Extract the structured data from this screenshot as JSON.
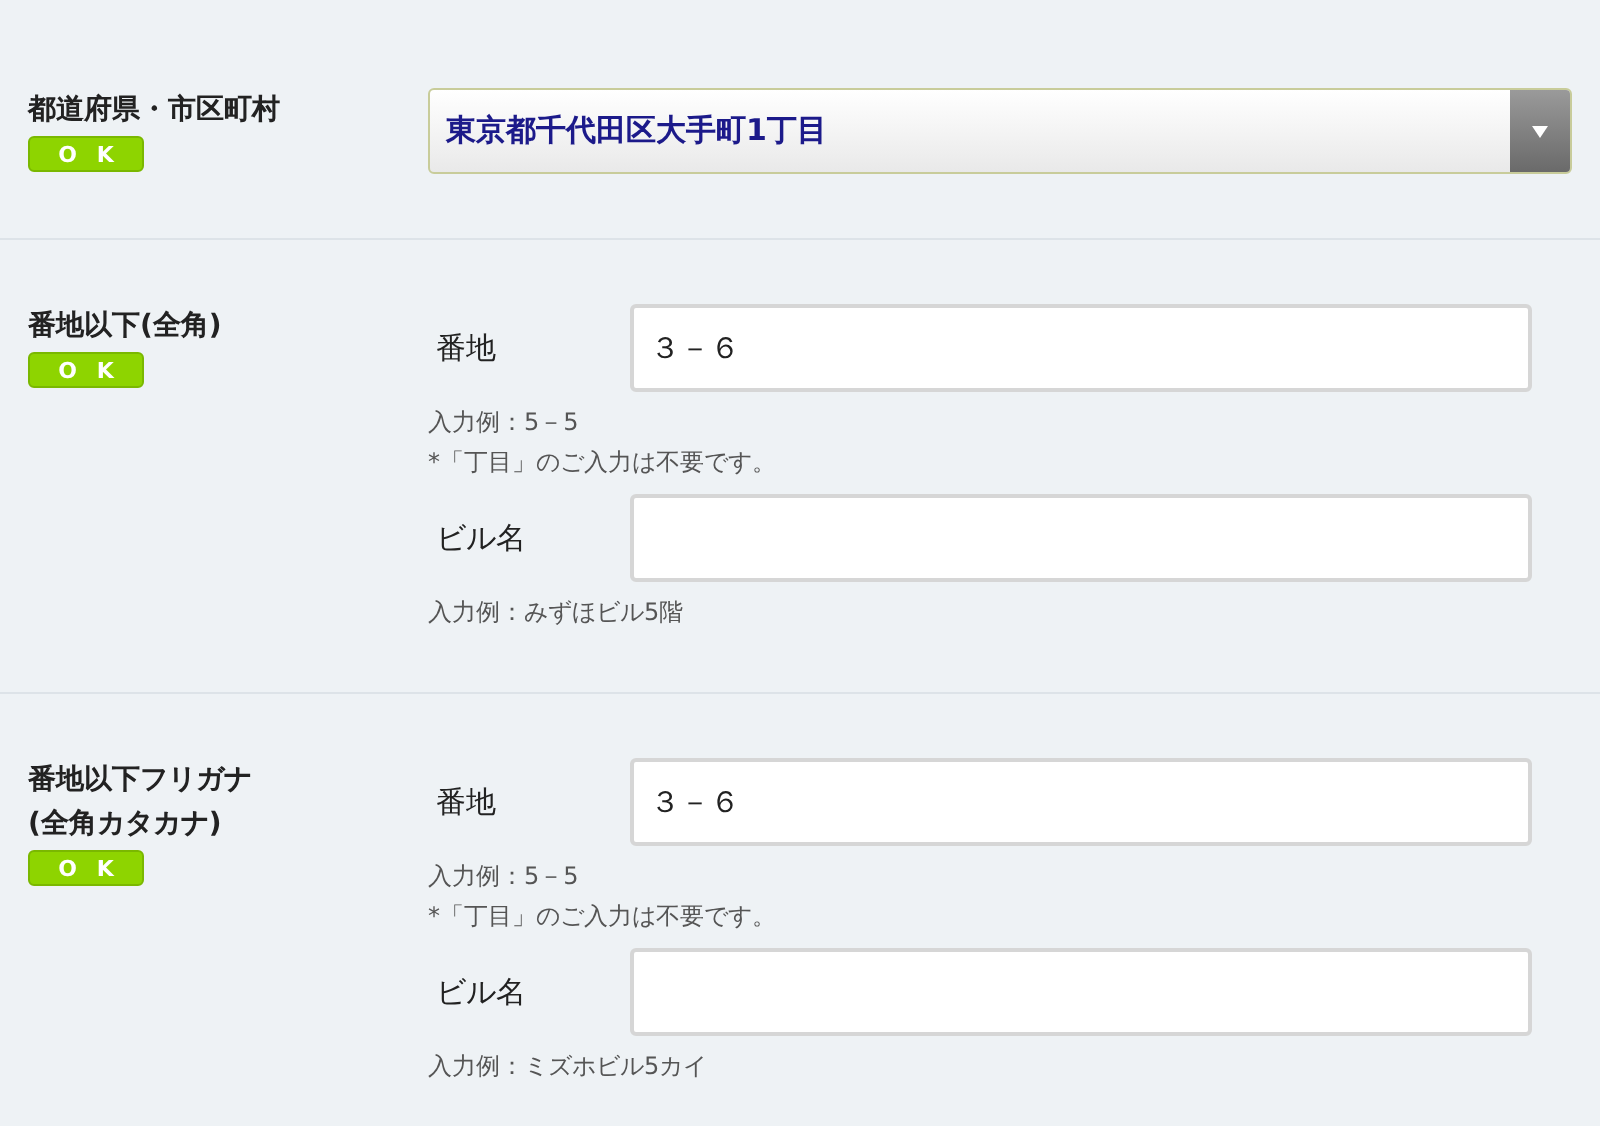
{
  "sections": [
    {
      "kind": "select",
      "label": [
        "都道府県・市区町村"
      ],
      "badge": "OK",
      "value": "東京都千代田区大手町1丁目"
    },
    {
      "kind": "fields",
      "label": [
        "番地以下(全角)"
      ],
      "badge": "OK",
      "fields": [
        {
          "label": "番地",
          "value": "３－６",
          "notes": [
            "入力例：5－5",
            "*「丁目」のご入力は不要です。"
          ]
        },
        {
          "label": "ビル名",
          "notes": [
            "入力例：みずほビル5階"
          ]
        }
      ]
    },
    {
      "kind": "fields",
      "label": [
        "番地以下フリガナ",
        "(全角カタカナ)"
      ],
      "badge": "OK",
      "fields": [
        {
          "label": "番地",
          "value": "３－６",
          "notes": [
            "入力例：5－5",
            "*「丁目」のご入力は不要です。"
          ]
        },
        {
          "label": "ビル名",
          "notes": [
            "入力例：ミズホビル5カイ"
          ]
        }
      ]
    }
  ]
}
